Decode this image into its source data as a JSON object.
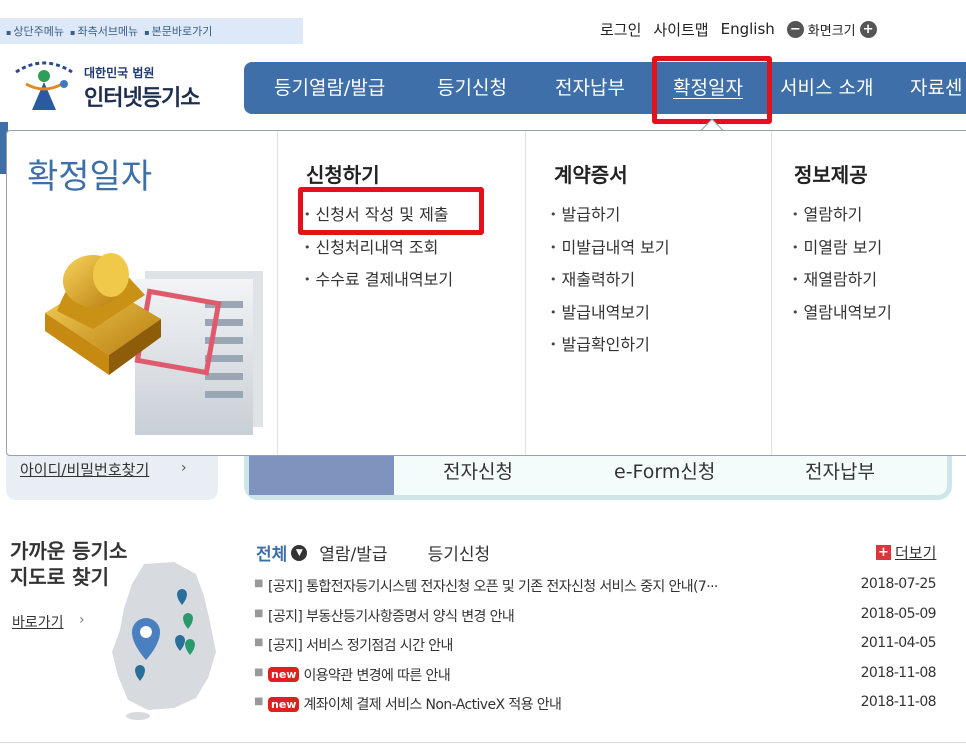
{
  "skip_links": [
    "상단주메뉴",
    "좌측서브메뉴",
    "본문바로가기"
  ],
  "utility": {
    "login": "로그인",
    "sitemap": "사이트맵",
    "english": "English",
    "font_size": "화면크기"
  },
  "logo": {
    "line1": "대한민국 법원",
    "line2": "인터넷등기소"
  },
  "gnb": [
    "등기열람/발급",
    "등기신청",
    "전자납부",
    "확정일자",
    "서비스 소개",
    "자료센"
  ],
  "gnb_active_index": 3,
  "mega": {
    "title": "확정일자",
    "columns": [
      {
        "heading": "신청하기",
        "items": [
          "신청서 작성 및 제출",
          "신청처리내역 조회",
          "수수료 결제내역보기"
        ]
      },
      {
        "heading": "계약증서",
        "items": [
          "발급하기",
          "미발급내역 보기",
          "재출력하기",
          "발급내역보기",
          "발급확인하기"
        ]
      },
      {
        "heading": "정보제공",
        "items": [
          "열람하기",
          "미열람 보기",
          "재열람하기",
          "열람내역보기"
        ]
      }
    ]
  },
  "login_area": {
    "find_account": "아이디/비밀번호찾기"
  },
  "shortcuts": [
    "전자신청",
    "e-Form신청",
    "전자납부"
  ],
  "nearest": {
    "title_line1": "가까운 등기소",
    "title_line2": "지도로 찾기",
    "go": "바로가기"
  },
  "notice_tabs": {
    "all": "전체",
    "view": "열람/발급",
    "apply": "등기신청",
    "more": "더보기"
  },
  "notices": [
    {
      "text": "[공지] 통합전자등기시스템 전자신청 오픈 및 기존 전자신청 서비스 중지 안내(7···",
      "date": "2018-07-25",
      "new": false
    },
    {
      "text": "[공지] 부동산등기사항증명서 양식 변경 안내",
      "date": "2018-05-09",
      "new": false
    },
    {
      "text": "[공지] 서비스 정기점검 시간 안내",
      "date": "2011-04-05",
      "new": false
    },
    {
      "text": "이용약관 변경에 따른 안내",
      "date": "2018-11-08",
      "new": true
    },
    {
      "text": "계좌이체 결제 서비스 Non-ActiveX 적용 안내",
      "date": "2018-11-08",
      "new": true
    }
  ],
  "new_badge": "new",
  "colors": {
    "primary": "#3e6fa8",
    "highlight": "#e4101b",
    "new_badge": "#e0201c"
  }
}
